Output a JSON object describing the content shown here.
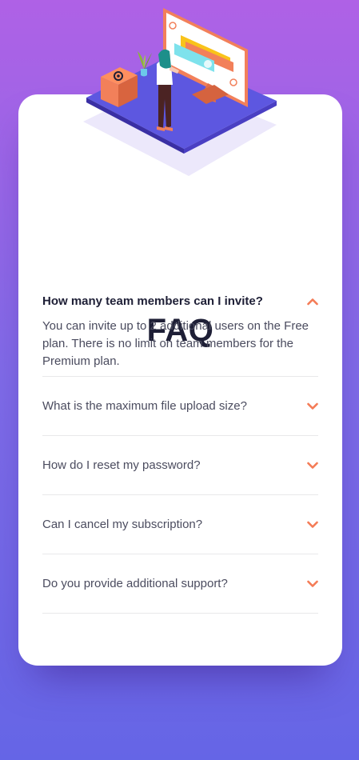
{
  "faq": {
    "title": "FAQ",
    "items": [
      {
        "question": "How many team members can I invite?",
        "answer": "You can invite up to 2 additional users on the Free plan. There is no limit on team members for the Premium plan.",
        "open": true
      },
      {
        "question": "What is the maximum file upload size?",
        "open": false
      },
      {
        "question": "How do I reset my password?",
        "open": false
      },
      {
        "question": "Can I cancel my subscription?",
        "open": false
      },
      {
        "question": "Do you provide additional support?",
        "open": false
      }
    ]
  },
  "colors": {
    "accent": "#f47b56",
    "title": "#1e1f36",
    "background_top": "#af61e6",
    "background_bottom": "#6565e6"
  }
}
